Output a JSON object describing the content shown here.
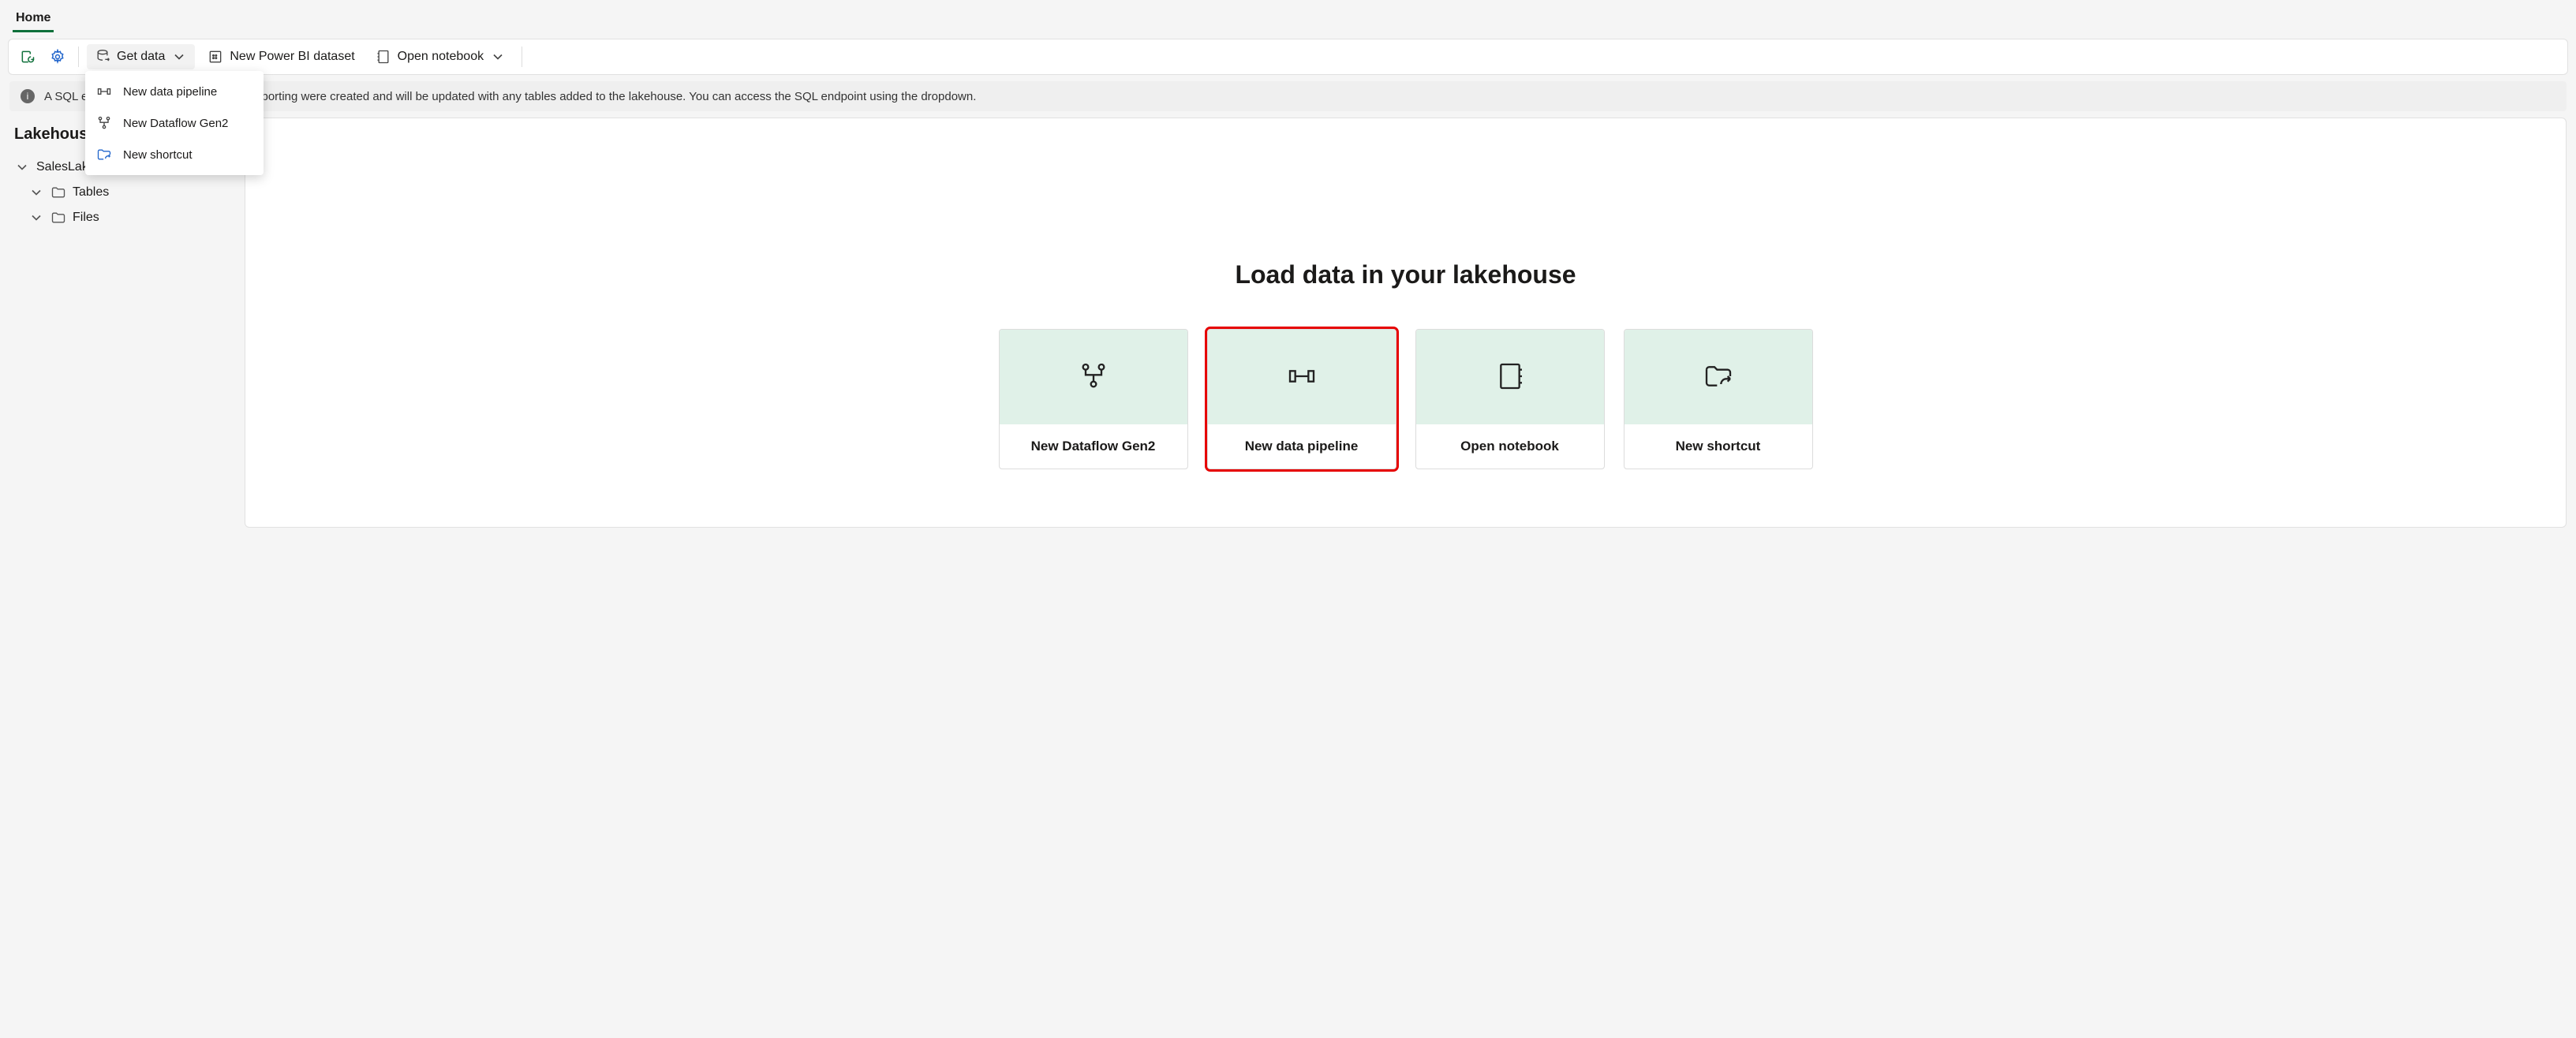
{
  "tabs": {
    "home": "Home"
  },
  "toolbar": {
    "get_data": "Get data",
    "new_pbi_dataset": "New Power BI dataset",
    "open_notebook": "Open notebook"
  },
  "get_data_menu": {
    "new_pipeline": "New data pipeline",
    "new_dataflow": "New Dataflow Gen2",
    "new_shortcut": "New shortcut"
  },
  "banner": {
    "visible_prefix": "A SQL e",
    "text": "A SQL endpoint and default dataset for reporting were created and will be updated with any tables added to the lakehouse. You can access the SQL endpoint using the dropdown."
  },
  "explorer": {
    "title": "Lakehouse explorer",
    "title_truncated": "Lakehouse",
    "root": "SalesLakehouse",
    "tables": "Tables",
    "files": "Files"
  },
  "canvas": {
    "heading": "Load data in your lakehouse",
    "cards": {
      "dataflow": "New Dataflow Gen2",
      "pipeline": "New data pipeline",
      "notebook": "Open notebook",
      "shortcut": "New shortcut"
    }
  }
}
